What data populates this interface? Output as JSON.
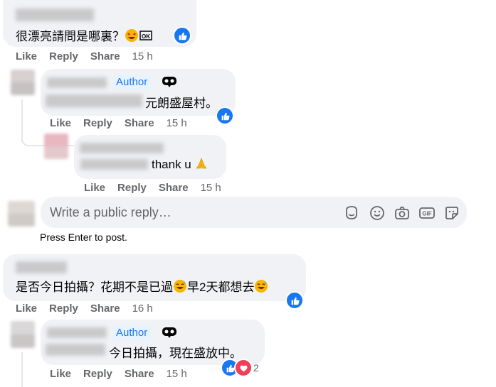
{
  "comments": [
    {
      "text": "很漂亮請問是哪裏？",
      "actions": {
        "like": "Like",
        "reply": "Reply",
        "share": "Share",
        "time": "15 h"
      }
    },
    {
      "author_badge": "Author",
      "text": "元朗盛屋村。",
      "actions": {
        "like": "Like",
        "reply": "Reply",
        "share": "Share",
        "time": "15 h"
      }
    },
    {
      "text": "thank u",
      "actions": {
        "like": "Like",
        "reply": "Reply",
        "share": "Share",
        "time": "15 h"
      }
    },
    {
      "text": "是否今日拍攝？花期不是已過",
      "text2": "早2天都想去",
      "actions": {
        "like": "Like",
        "reply": "Reply",
        "share": "Share",
        "time": "16 h"
      }
    },
    {
      "author_badge": "Author",
      "text": "今日拍攝，現在盛放中。",
      "reaction_count": "2",
      "actions": {
        "like": "Like",
        "reply": "Reply",
        "share": "Share",
        "time": "15 h"
      }
    }
  ],
  "reply_box": {
    "placeholder": "Write a public reply…",
    "hint": "Press Enter to post.",
    "tools": [
      "sticker-face-icon",
      "emoji-smile-icon",
      "camera-icon",
      "gif-icon",
      "sticker-icon"
    ]
  },
  "colors": {
    "accent": "#1877f2",
    "bubble": "#f0f2f5",
    "muted": "#65676b",
    "love": "#f33e58"
  }
}
